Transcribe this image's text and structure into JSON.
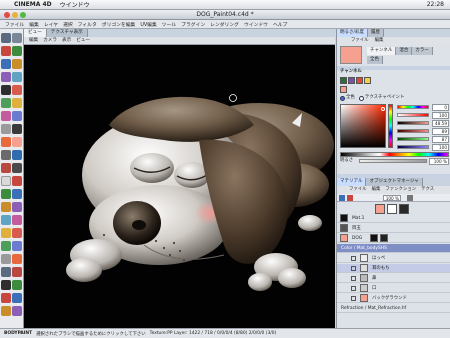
{
  "os_menubar": {
    "app_name": "CINEMA 4D",
    "window_menu": "ウインドウ",
    "clock": "22:28"
  },
  "window": {
    "title": "DOG_Paint04.c4d *"
  },
  "app_menu": [
    "ファイル",
    "編集",
    "レイヤ",
    "選択",
    "フィルタ",
    "ポリゴンを編集",
    "UV編集",
    "ツール",
    "プラグイン",
    "レンダリング",
    "ウインドウ",
    "ヘルプ"
  ],
  "viewport": {
    "tabs": [
      "ビュー",
      "テクスチャ表示"
    ],
    "menu": [
      "編集",
      "カメラ",
      "表示",
      "ビュー"
    ]
  },
  "color_panel": {
    "tabs": [
      "明るさ/彩度",
      "履歴"
    ],
    "menu": [
      "ファイル",
      "編集"
    ],
    "subtabs": [
      "チャンネル",
      "混合",
      "カラー"
    ],
    "subtab2": "全色",
    "channel_label": "チャンネル",
    "radio_1": "全色",
    "radio_2": "テクスチャペイント",
    "values": [
      "0",
      "100",
      "48.59",
      "89",
      "87",
      "100"
    ],
    "brightness_label": "明るさ",
    "brightness_value": "100 %",
    "base_color": "#f6a08f"
  },
  "object_panel": {
    "tabs": [
      "マテリアル",
      "オブジェクトマネージャ"
    ],
    "menu": [
      "ファイル",
      "編集",
      "ファンクション",
      "テクス"
    ],
    "zoom": "100 %",
    "layers": [
      {
        "name": "Mat.1"
      },
      {
        "name": "目玉"
      },
      {
        "name": "DOG"
      },
      {
        "name": "Color / Mat_bodySHS"
      },
      {
        "name": "ほっぺ"
      },
      {
        "name": "耳のもち"
      },
      {
        "name": "鼻"
      },
      {
        "name": "口"
      },
      {
        "name": "バックグラウンド"
      },
      {
        "name": "Refraction / Mat_Refraction.hf"
      }
    ]
  },
  "status_bar": {
    "app": "BODYPAINT",
    "message": "選択されたブラシで描画するためにクリックして下さい",
    "info": "Texture:PP Layer: 1422 / 718 / 0/0/0/4 (8/80) 2/0/0/0 (3/0)"
  },
  "colors": {
    "accent_tab": "#c8ddff",
    "selected_row": "#7f8fc6",
    "viewport_bg": "#020202"
  }
}
